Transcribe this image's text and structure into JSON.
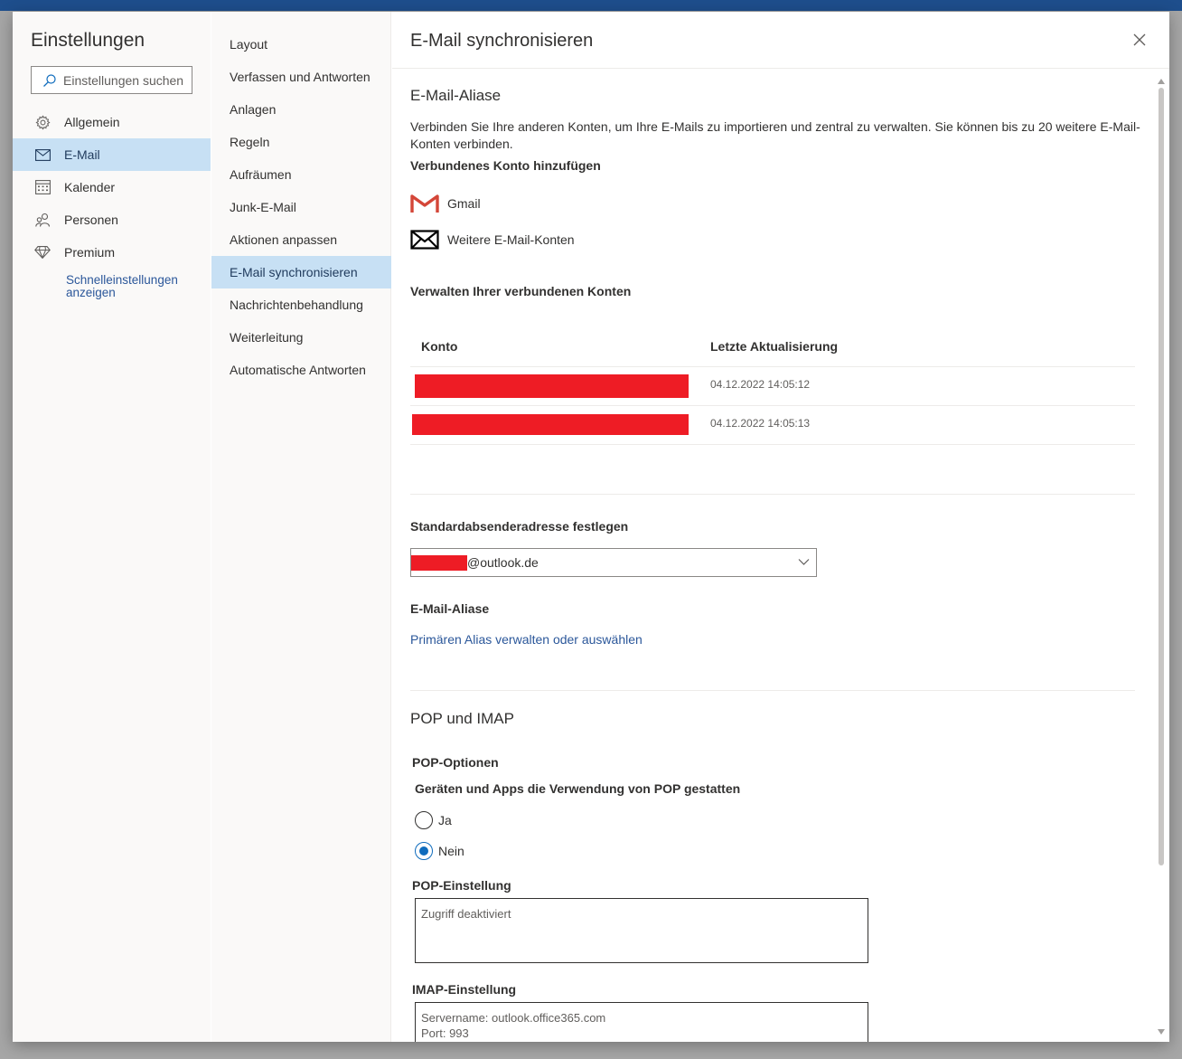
{
  "left_nav": {
    "title": "Einstellungen",
    "search_placeholder": "Einstellungen suchen",
    "items": [
      {
        "label": "Allgemein",
        "icon": "gear-icon"
      },
      {
        "label": "E-Mail",
        "icon": "mail-icon"
      },
      {
        "label": "Kalender",
        "icon": "calendar-icon"
      },
      {
        "label": "Personen",
        "icon": "people-icon"
      },
      {
        "label": "Premium",
        "icon": "diamond-icon"
      }
    ],
    "selected_index": 1,
    "quick_settings": "Schnelleinstellungen anzeigen"
  },
  "sub_nav": {
    "items": [
      "Layout",
      "Verfassen und Antworten",
      "Anlagen",
      "Regeln",
      "Aufräumen",
      "Junk-E-Mail",
      "Aktionen anpassen",
      "E-Mail synchronisieren",
      "Nachrichtenbehandlung",
      "Weiterleitung",
      "Automatische Antworten"
    ],
    "selected_index": 7
  },
  "content": {
    "title": "E-Mail synchronisieren",
    "aliases_heading": "E-Mail-Aliase",
    "description": "Verbinden Sie Ihre anderen Konten, um Ihre E-Mails zu importieren und zentral zu verwalten. Sie können bis zu 20 weitere E-Mail-Konten verbinden.",
    "add_account_heading": "Verbundenes Konto hinzufügen",
    "add_options": [
      {
        "label": "Gmail",
        "icon": "gmail-icon"
      },
      {
        "label": "Weitere E-Mail-Konten",
        "icon": "envelope-icon"
      }
    ],
    "manage_heading": "Verwalten Ihrer verbundenen Konten",
    "table": {
      "columns": [
        "Konto",
        "Letzte Aktualisierung"
      ],
      "rows": [
        {
          "account": "",
          "updated": "04.12.2022 14:05:12"
        },
        {
          "account": "",
          "updated": "04.12.2022 14:05:13"
        }
      ]
    },
    "default_sender_heading": "Standardabsenderadresse festlegen",
    "default_sender_value": "@outlook.de",
    "alias_subheading": "E-Mail-Aliase",
    "alias_link": "Primären Alias verwalten oder auswählen",
    "pop_imap_heading": "POP und IMAP",
    "pop_options_heading": "POP-Optionen",
    "pop_question": "Geräten und Apps die Verwendung von POP gestatten",
    "pop_radio": [
      {
        "label": "Ja",
        "checked": false
      },
      {
        "label": "Nein",
        "checked": true
      }
    ],
    "pop_setting_heading": "POP-Einstellung",
    "pop_setting_value": "Zugriff deaktiviert",
    "imap_setting_heading": "IMAP-Einstellung",
    "imap_setting_value": "Servername: outlook.office365.com\nPort: 993"
  },
  "colors": {
    "accent": "#0f6cbd",
    "selected_bg": "#c7e0f4",
    "redaction": "#ee1c25",
    "link": "#2b579a"
  }
}
